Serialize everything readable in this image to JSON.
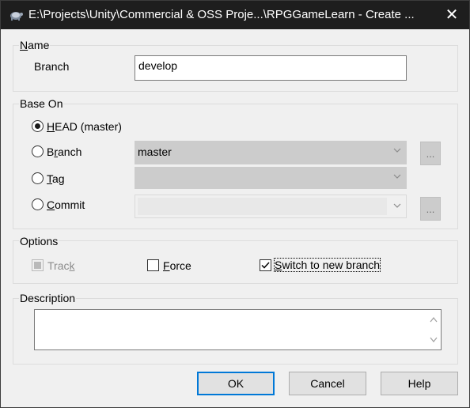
{
  "window": {
    "title": "E:\\Projects\\Unity\\Commercial & OSS Proje...\\RPGGameLearn - Create ...",
    "close_label": "✕"
  },
  "name_group": {
    "label": "Name",
    "branch_label": "Branch",
    "branch_value": "develop"
  },
  "base_on": {
    "label": "Base On",
    "head": {
      "label": "HEAD (master)",
      "selected": true
    },
    "branch": {
      "label": "Branch",
      "selected": false,
      "value": "master"
    },
    "tag": {
      "label": "Tag",
      "selected": false,
      "value": ""
    },
    "commit": {
      "label": "Commit",
      "selected": false,
      "value": ""
    },
    "browse_label": "..."
  },
  "options": {
    "label": "Options",
    "track": {
      "label": "Track",
      "checked": true,
      "enabled": false
    },
    "force": {
      "label": "Force",
      "checked": false
    },
    "switch": {
      "label": "Switch to new branch",
      "checked": true
    }
  },
  "description": {
    "label": "Description",
    "value": ""
  },
  "buttons": {
    "ok": "OK",
    "cancel": "Cancel",
    "help": "Help"
  },
  "colors": {
    "titlebar": "#1e1e1e",
    "accent": "#0078d7",
    "dialog_bg": "#f0f0f0"
  }
}
